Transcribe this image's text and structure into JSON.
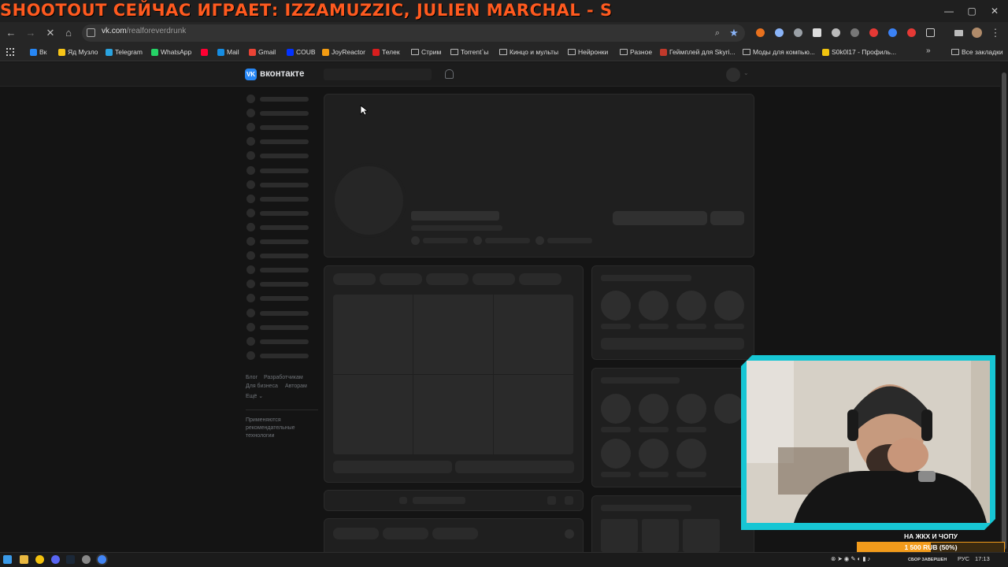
{
  "ticker": {
    "text": "SHOOTOUT СЕЙЧАС ИГРАЕТ: IZZAMUZZIC, JULIEN MARCHAL - S"
  },
  "window_controls": {
    "minimize": "—",
    "maximize": "▢",
    "close": "✕"
  },
  "browser": {
    "url_host": "vk.com",
    "url_path": "/realforeverdrunk"
  },
  "bookmarks": [
    {
      "label": "Вк",
      "color": "#2787f5"
    },
    {
      "label": "Яд Музло",
      "color": "#f7c518"
    },
    {
      "label": "Telegram",
      "color": "#2aa3df"
    },
    {
      "label": "WhatsApp",
      "color": "#25d366"
    },
    {
      "label": "",
      "color": "#ff0033"
    },
    {
      "label": "Mail",
      "color": "#168de2"
    },
    {
      "label": "Gmail",
      "color": "#ea4335"
    },
    {
      "label": "COUB",
      "color": "#0332ff"
    },
    {
      "label": "JoyReactor",
      "color": "#f39c12"
    },
    {
      "label": "Телек",
      "color": "#d81e1e"
    },
    {
      "label": "Стрим",
      "folder": true
    },
    {
      "label": "Torrent`ы",
      "folder": true
    },
    {
      "label": "Кинцо и мульты",
      "folder": true
    },
    {
      "label": "Нейронки",
      "folder": true
    },
    {
      "label": "Разное",
      "folder": true
    },
    {
      "label": "Геймплей для Skyri...",
      "color": "#c0392b"
    },
    {
      "label": "Моды для компью...",
      "folder": true
    },
    {
      "label": "S0k0l17 - Профиль...",
      "color": "#f1c40f"
    },
    {
      "label": "Все закладки",
      "folder": true
    }
  ],
  "vk": {
    "logo_text": "вконтакте",
    "logo_badge": "VK",
    "footer_links": [
      {
        "label": "Блог"
      },
      {
        "label": "Разработчикам"
      },
      {
        "label": "Для бизнеса"
      },
      {
        "label": "Авторам"
      },
      {
        "label": "Ещё ⌄"
      }
    ],
    "recommend_note": "Применяются рекомендательные технологии"
  },
  "donation": {
    "title": "НА ЖКХ И ЧОПУ",
    "amount": "1 500 RUB (50%)",
    "progress": 0.5,
    "fill_color": "#f29b1b"
  },
  "taskbar": {
    "language": "РУС",
    "time": "17:13",
    "tray_label": "СБОР ЗАВЕРШЕН"
  }
}
